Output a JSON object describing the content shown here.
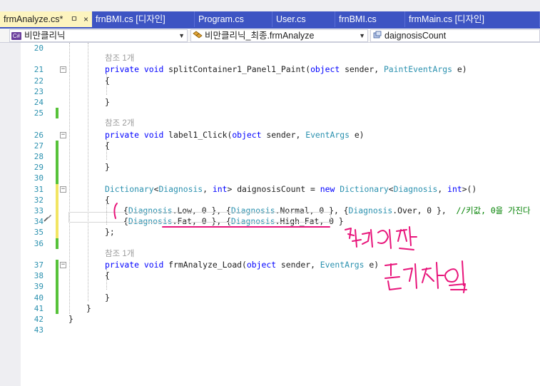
{
  "tabs": [
    {
      "label": "frmAnalyze.cs*",
      "active": true,
      "pin": "ㅁ",
      "close": "×"
    },
    {
      "label": "frnBMI.cs [디자인]",
      "active": false
    },
    {
      "label": "Program.cs",
      "active": false
    },
    {
      "label": "User.cs",
      "active": false
    },
    {
      "label": "frnBMI.cs",
      "active": false
    },
    {
      "label": "frmMain.cs [디자인]",
      "active": false
    }
  ],
  "nav": {
    "project": "비만클리닉",
    "project_badge": "C#",
    "class": "비만클리닉_최종.frmAnalyze",
    "member": "daignosisCount"
  },
  "lines": [
    {
      "num": "20",
      "chg": "",
      "fold": "",
      "ref": ""
    },
    {
      "num": "21",
      "chg": "",
      "fold": "⊟",
      "ref": "참조 1개",
      "code": [
        "private void splitContainer1_Panel1_Paint(object sender, PaintEventArgs e)"
      ]
    },
    {
      "num": "22",
      "chg": "",
      "fold": "",
      "code": [
        "{"
      ]
    },
    {
      "num": "23",
      "chg": "",
      "fold": "",
      "code": [
        ""
      ]
    },
    {
      "num": "24",
      "chg": "",
      "fold": "",
      "code": [
        "}"
      ]
    },
    {
      "num": "25",
      "chg": "green",
      "fold": "",
      "code": [
        ""
      ]
    },
    {
      "num": "26",
      "chg": "",
      "fold": "⊟",
      "ref": "참조 2개",
      "code": [
        "private void label1_Click(object sender, EventArgs e)"
      ]
    },
    {
      "num": "27",
      "chg": "green",
      "fold": "",
      "code": [
        "{"
      ]
    },
    {
      "num": "28",
      "chg": "green",
      "fold": "",
      "code": [
        ""
      ]
    },
    {
      "num": "29",
      "chg": "green",
      "fold": "",
      "code": [
        "}"
      ]
    },
    {
      "num": "30",
      "chg": "green",
      "fold": "",
      "code": [
        ""
      ]
    },
    {
      "num": "31",
      "chg": "yellow",
      "fold": "⊟",
      "code": [
        "Dictionary<Diagnosis, int> daignosisCount = new Dictionary<Diagnosis, int>()"
      ]
    },
    {
      "num": "32",
      "chg": "yellow",
      "fold": "",
      "code": [
        "{"
      ]
    },
    {
      "num": "33",
      "chg": "yellow",
      "fold": "",
      "code": [
        "{Diagnosis.Low, 0 }, {Diagnosis.Normal, 0 }, {Diagnosis.Over, 0 },  //키값, 0을 가진다"
      ]
    },
    {
      "num": "34",
      "chg": "yellow",
      "fold": "",
      "code": [
        "{Diagnosis.Fat, 0 }, {Diagnosis.High_Fat, 0 }"
      ]
    },
    {
      "num": "35",
      "chg": "yellow",
      "fold": "",
      "code": [
        "};"
      ]
    },
    {
      "num": "36",
      "chg": "green",
      "fold": "",
      "code": [
        ""
      ]
    },
    {
      "num": "37",
      "chg": "green",
      "fold": "⊟",
      "ref": "참조 1개",
      "code": [
        "private void frmAnalyze_Load(object sender, EventArgs e)"
      ]
    },
    {
      "num": "38",
      "chg": "green",
      "fold": "",
      "code": [
        "{"
      ]
    },
    {
      "num": "39",
      "chg": "green",
      "fold": "",
      "code": [
        ""
      ]
    },
    {
      "num": "40",
      "chg": "green",
      "fold": "",
      "code": [
        "}"
      ]
    },
    {
      "num": "41",
      "chg": "green",
      "fold": "",
      "code": [
        "}"
      ]
    },
    {
      "num": "42",
      "chg": "",
      "fold": "",
      "code": [
        "}"
      ]
    },
    {
      "num": "43",
      "chg": "",
      "fold": "",
      "code": [
        ""
      ]
    }
  ],
  "colors": {
    "accent": "#3d54c3",
    "active_tab": "#fdf4bf",
    "keyword": "#0000ff",
    "type": "#2b91af",
    "comment": "#008000",
    "ink": "#e8147a",
    "change_saved": "#57c23a",
    "change_unsaved": "#f2e563"
  },
  "icons": {
    "nav_class": "class-icon",
    "nav_member": "field-icon",
    "edit_glyph": "screwdriver-icon"
  }
}
